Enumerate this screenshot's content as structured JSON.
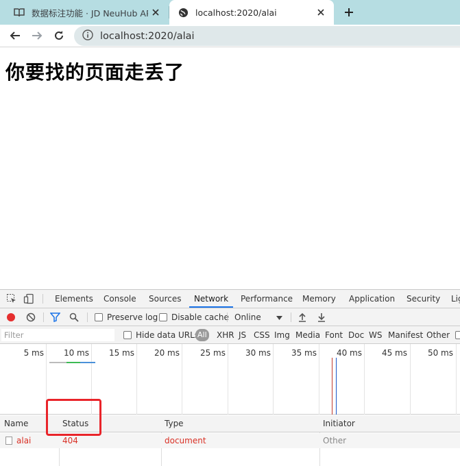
{
  "browser": {
    "tabs": [
      {
        "title": "数据标注功能 · JD NeuHub API",
        "icon": "book-icon",
        "active": false
      },
      {
        "title": "localhost:2020/alai",
        "icon": "globe-icon",
        "active": true
      }
    ],
    "address": "localhost:2020/alai",
    "accent": "#b6dde2"
  },
  "page": {
    "heading": "你要找的页面走丢了"
  },
  "devtools": {
    "tabs": [
      "Elements",
      "Console",
      "Sources",
      "Network",
      "Performance",
      "Memory",
      "Application",
      "Security",
      "Lig"
    ],
    "selected_tab": "Network",
    "toolbar": {
      "preserve_log": "Preserve log",
      "disable_cache": "Disable cache",
      "throttle": "Online"
    },
    "filter": {
      "placeholder": "Filter",
      "hide_data_urls": "Hide data URLs",
      "types": [
        "All",
        "XHR",
        "JS",
        "CSS",
        "Img",
        "Media",
        "Font",
        "Doc",
        "WS",
        "Manifest",
        "Other"
      ]
    },
    "timeline": {
      "ticks": [
        "5 ms",
        "10 ms",
        "15 ms",
        "20 ms",
        "25 ms",
        "30 ms",
        "35 ms",
        "40 ms",
        "45 ms",
        "50 ms"
      ]
    },
    "grid": {
      "columns": [
        "Name",
        "Status",
        "Type",
        "Initiator"
      ],
      "rows": [
        {
          "name": "alai",
          "status": "404",
          "type": "document",
          "initiator": "Other"
        }
      ]
    },
    "colors": {
      "error": "#d93025",
      "highlight": "#e9242a",
      "selected_underline": "#1a73e8"
    }
  }
}
